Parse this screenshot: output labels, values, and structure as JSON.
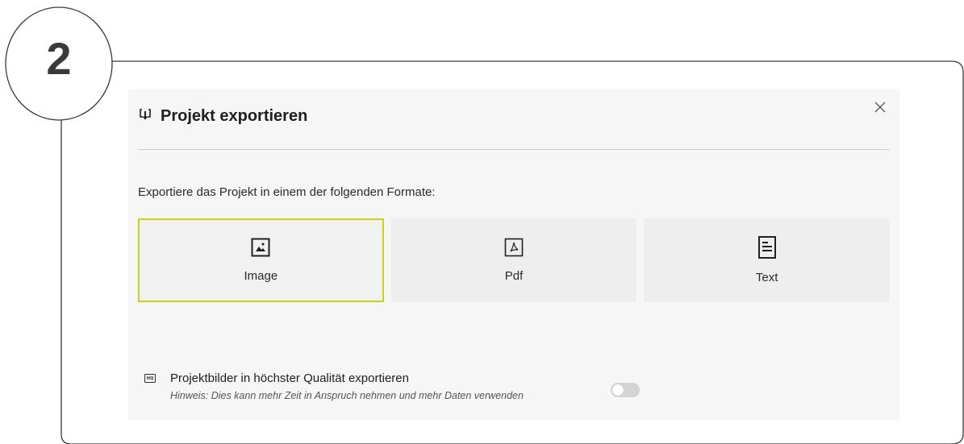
{
  "step": {
    "number": "2"
  },
  "dialog": {
    "title": "Projekt exportieren",
    "prompt": "Exportiere das Projekt in einem der folgenden Formate:",
    "formats": [
      {
        "label": "Image",
        "icon": "image-icon",
        "selected": true
      },
      {
        "label": "Pdf",
        "icon": "pdf-icon",
        "selected": false
      },
      {
        "label": "Text",
        "icon": "text-document-icon",
        "selected": false
      }
    ],
    "hq_option": {
      "badge": "HQ",
      "title": "Projektbilder in höchster Qualität exportieren",
      "hint": "Hinweis: Dies kann mehr Zeit in Anspruch nehmen und mehr Daten verwenden",
      "enabled": false
    }
  },
  "colors": {
    "selected_border": "#c8d31a",
    "dialog_background": "#f6f6f6",
    "card_background": "#eeeeee"
  }
}
